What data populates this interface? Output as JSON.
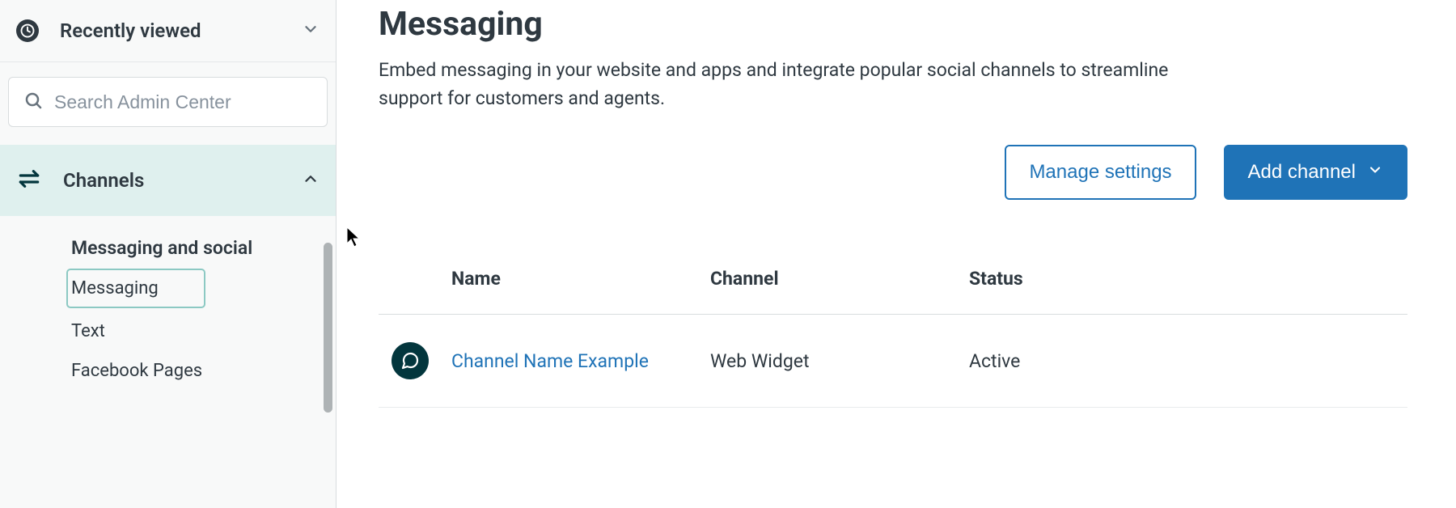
{
  "sidebar": {
    "recent_label": "Recently viewed",
    "search_placeholder": "Search Admin Center",
    "section_label": "Channels",
    "subgroup_title": "Messaging and social",
    "items": [
      {
        "label": "Messaging"
      },
      {
        "label": "Text"
      },
      {
        "label": "Facebook Pages"
      }
    ]
  },
  "page": {
    "title": "Messaging",
    "description": "Embed messaging in your website and apps and integrate popular social channels to streamline support for customers and agents."
  },
  "actions": {
    "manage": "Manage settings",
    "add": "Add channel"
  },
  "table": {
    "headers": {
      "name": "Name",
      "channel": "Channel",
      "status": "Status"
    },
    "rows": [
      {
        "name": "Channel Name Example",
        "channel": "Web Widget",
        "status": "Active"
      }
    ]
  }
}
